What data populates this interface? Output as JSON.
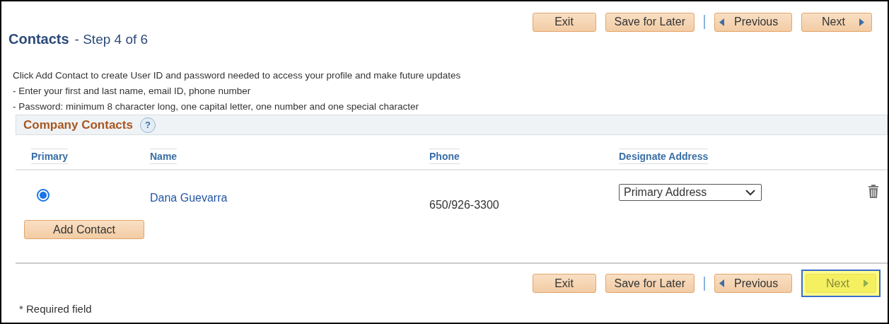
{
  "top_toolbar": [
    {
      "label": "Exit",
      "kind": "plain",
      "highlighted": false
    },
    {
      "label": "Save for Later",
      "kind": "plain",
      "highlighted": false
    },
    {
      "label": "Previous",
      "kind": "previous",
      "highlighted": false
    },
    {
      "label": "Next",
      "kind": "next",
      "highlighted": false
    }
  ],
  "title": "Contacts",
  "step": "- Step 4 of 6",
  "instructions": [
    "Click Add Contact to create User ID and password needed to access your profile and make future updates",
    "- Enter your first and last name, email ID, phone number",
    "- Password: minimum 8 character long, one capital letter, one number and one special character"
  ],
  "section": {
    "title": "Company Contacts",
    "help": "?"
  },
  "table": {
    "columns": [
      "Primary",
      "Name",
      "Phone",
      "Designate Address"
    ],
    "rows": [
      {
        "selected": true,
        "name": "Dana Guevarra",
        "phone": "650/926-3300",
        "address": "Primary Address"
      }
    ]
  },
  "add_button": "Add Contact",
  "bottom_toolbar": [
    {
      "label": "Exit",
      "kind": "plain",
      "highlighted": false
    },
    {
      "label": "Save for Later",
      "kind": "plain",
      "highlighted": false
    },
    {
      "label": "Previous",
      "kind": "previous",
      "highlighted": false
    },
    {
      "label": "Next",
      "kind": "next",
      "highlighted": true
    }
  ],
  "footnote": "* Required field"
}
